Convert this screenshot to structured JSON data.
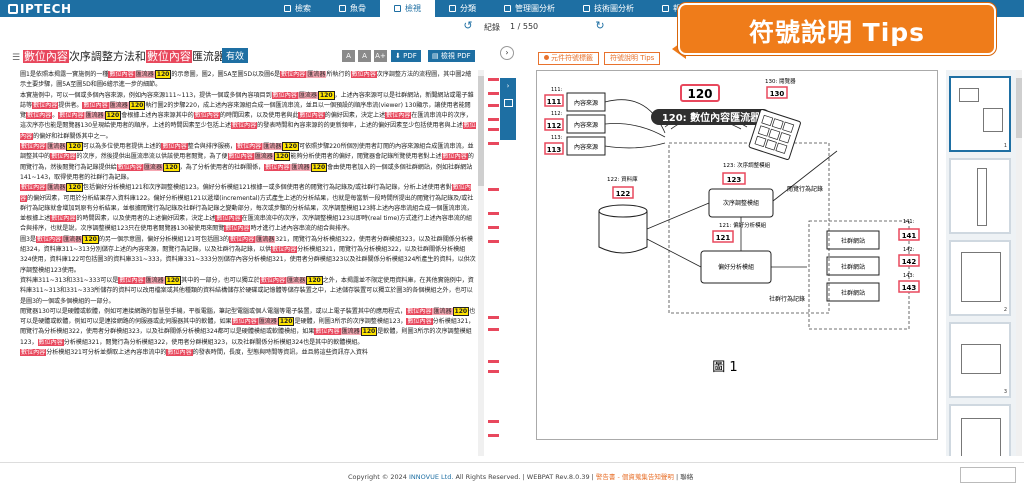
{
  "app": {
    "logo_text": "IPTECH",
    "nav_tabs": [
      {
        "label": "檢索",
        "icon": "search-icon"
      },
      {
        "label": "魚骨",
        "icon": "fishbone-icon"
      },
      {
        "label": "檢視",
        "icon": "view-icon",
        "active": true
      },
      {
        "label": "分類",
        "icon": "category-icon"
      },
      {
        "label": "管理圖分析",
        "icon": "chart-icon"
      },
      {
        "label": "技術圖分析",
        "icon": "tech-chart-icon"
      },
      {
        "label": "報告",
        "icon": "report-icon"
      },
      {
        "label": "系",
        "icon": "system-icon"
      }
    ]
  },
  "record": {
    "label": "紀錄",
    "value": "1 / 550"
  },
  "document": {
    "title_parts": [
      {
        "text": "數位內容",
        "style": "hl"
      },
      {
        "text": "次序調整方法和",
        "style": ""
      },
      {
        "text": "數位內容",
        "style": "hl"
      },
      {
        "text": "匯流器",
        "style": ""
      }
    ],
    "valid_badge": "有效",
    "font_buttons": [
      "A",
      "A",
      "A+"
    ],
    "pdf_button": "PDF",
    "view_pdf_button": "檢視 PDF",
    "paragraphs": [
      "圖1是依照本揭露一實施例的一種數位內容匯流器 120 的示意圖，圖2，圖5A至圖5D以及圖6是數位內容匯流器所執行的數位內容次序調整方法的流程圖，其中圖2繪示主要步驟，圖5A至圖5D和圖6繪示進一步的細節。",
      "本實施例中，可以一個或多個內容來源，例如內容來源111~113，提供一個或多個內容項目到數位內容匯流器 120 ，上述內容來源可以是社群網站，新聞網站或電子雜誌等數位內容提供者。數位內容匯流器 120 執行圖2的步驟220，成上述內容來源組合成一個匯流串流，並且以一個預設的順序串流(viewer) 130顯示，讓使用者能閱覽數位內容。數位內容匯流器 120 會根據上述內容來源其中的數位內容的時間因素，以及使用者與此數位內容的偏好因素，決定上述數位內容在匯流串流中的次序，這次序亦也能是閱覽器130呈現給使用者的順序，上述的時間因素至少包括上述數位內容的發表時間和內容來源的的更新頻率，上述的偏好因素至少包括使用者與上述數位內容的偏好和社群關係其中之一。",
      "數位內容匯流器 120 可以為多位使用者提供上述的數位內容整合與排序服務，數位內容匯流器 120 可依照步驟220所個別使用者訂閱的內容來源組合成匯流串流，並調整其中的數位內容的次序，然後提供出匯流串流以供該使用者閱覽，為了便數位內容匯流器 120 能夠分析使用者的偏好，閱覽器會記錄所覽使用者對上述數位內容的閱覽行為，然後閱覽行為記錄提供給數位內容匯流器 120 ，為了分析使用者的社群關係，數位內容匯流器 120 會由使用者加入的一個或多個社群網站，例如社群網站141~143，取得使用者的社群行為記錄。",
      "數位內容匯流器 120 包括偏好分析模組121和次序調整模組123。偏好分析模組121根據一或多個使用者的閱覽行為記錄及/或社群行為記錄，分析上述使用者對數位內容的偏好因素，可用於分析結果存入資料庫122。偏好分析模組121以遞增(incremental)方式產生上述的分析結果，也就是每當新一段時間所提出的閱覽行為記錄及/或社群行為記錄就會增加到原有分析結果，並根據閱覽行為記錄及社群行為記錄之變動部分，每次或步驟的分析結果，次序調整模組123將上述內容串流組合成一個匯流串流，並根據上述數位內容的時間因素，以及使用者的上述偏好因素，決定上述數位內容在匯流串流中的次序，次序調整模組123以即時(real time)方式進行上述內容串流的組合與排序，也就是說，次序調整模組123只在使用者閱覽器130被使用來閱覽數位內容時才進行上述內容串流的組合與排序。",
      "圖3是數位內容匯流器 120 的另一個示意圖，偏好分析模組121可包括圖3的數位內容匯流器321，閱覽行為分析模組322，使用者分群模組323，以及社群關係分析模組324，資料庫311~313分別儲存上述的內容來源，閱覽行為記錄，以及社群行為記錄，以供數位內容分析模組321，閱覽行為分析模組322，以及社群關係分析模組324使用，資料庫122可包括圖3的資料庫331~333，資料庫331~333分別儲存內容分析模組321，使用者分群模組323以及社群關係分析模組324所產生的資料，以供次序調整模組123使用。",
      "資料庫311~313和331~333可以是數位內容匯流器 120 其中的一部分，也可以獨立於數位內容匯流器 120 之外，本揭露並不限定使用資料庫，在其他實施例中，資料庫311~313和331~333所儲存的資料可以改用檔案或其他種類的資料結構儲存於硬碟或記憶體等儲存裝置之中，上述儲存裝置可以獨立於圖3的各個模組之外，也可以是圖3的一個或多個模組的一部分。",
      "閱覽器130可以是硬體或軟體，例如可連接網路的智慧型手機，平板電腦，筆記型電腦或個人電腦等電子裝置，或以上電子裝置其中的應用程式，數位內容匯流器 120 也可以是硬體或軟體，例如可以是連接網路的伺服器或此伺服器其中的軟體，如果數位內容匯流器 120 是硬體，則圖3所示的次序調整模組123，數位內容分析模組321，閱覽行為分析模組322，使用者分群模組323，以及社群關係分析模組324都可以是硬體模組或軟體模組，如果數位內容匯流器 120 是軟體，則圖3所示的次序調整模組123，數位內容分析模組321，閱覽行為分析模組322，使用者分群模組323，以及社群關係分析模組324也是其中的軟體模組。",
      "數位內容分析模組321可分析並擷取上述內容串流中的數位內容的發表時間，長度，型態與時間等資訊，並且將這些資訊存入資料"
    ]
  },
  "figure": {
    "tab_component_list": "元件符號標籤",
    "tab_symbol_tips": "符號說明 Tips",
    "caption": "圖 1",
    "tooltip_ref": "120",
    "tooltip_text": "120: 數位內容匯流器",
    "labels": {
      "source_box": "內容來源",
      "db_label": "122: 資料庫",
      "order_label": "123: 次序調整模組",
      "order_box": "次序調整模組",
      "pref_label": "121: 偏好分析模組",
      "pref_box": "偏好分析模組",
      "browse_label": "閱覽行為記錄",
      "social_label": "社群行為記錄",
      "network_box": "社群網站",
      "viewer_label": "130: 閱覽器"
    },
    "refs": {
      "r111": "111",
      "r112": "112",
      "r113": "113",
      "r111_small": "111:",
      "r112_small": "112:",
      "r113_small": "113:",
      "r120": "120",
      "r122": "122",
      "r123": "123",
      "r121": "121",
      "r130": "130",
      "r141": "141",
      "r142": "142",
      "r143": "143",
      "r141_small": "141:",
      "r142_small": "142:",
      "r143_small": "143:"
    }
  },
  "thumbs": {
    "pages": [
      "1",
      "2",
      "3"
    ]
  },
  "callout": {
    "text": "符號說明 Tips"
  },
  "footer": {
    "copyright": "Copyright © 2024 ",
    "company": "INNOVUE Ltd.",
    "rights": " All Rights Reserved. | WEBPAT Rev.8.0.39 | ",
    "warn": "警告書 - 個資蒐集告知聲明",
    "tail": " | 聯絡"
  },
  "colors": {
    "brand": "#1e6fa3",
    "highlight_red": "#e8485d",
    "highlight_yellow": "#ffe400",
    "accent_orange": "#ef7c1a"
  }
}
